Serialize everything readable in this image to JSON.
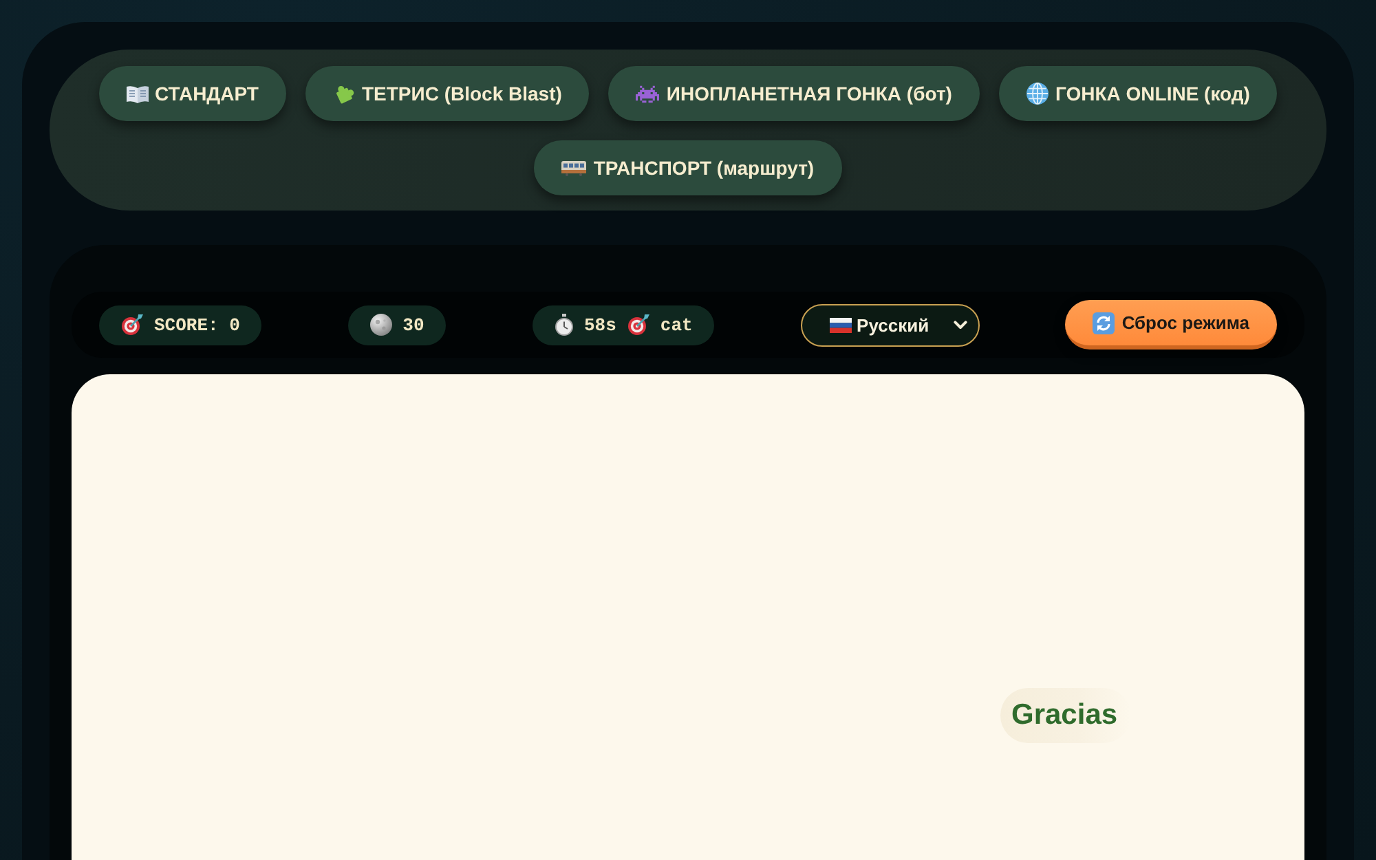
{
  "modes": [
    {
      "label": "СТАНДАРТ",
      "selected": false
    },
    {
      "label": "ТЕТРИС (Block Blast)",
      "selected": false
    },
    {
      "label": "ИНОПЛАНЕТНАЯ ГОНКА (бот)",
      "selected": false
    },
    {
      "label": "ГОНКА ONLINE (код)",
      "selected": false
    },
    {
      "label": "ТРАНСПОРТ (маршрут)",
      "selected": false
    }
  ],
  "stats": {
    "score": "SCORE: 0",
    "moons": "30",
    "time": "58s",
    "target": "cat"
  },
  "language_select": {
    "value": "Русский"
  },
  "reset_button": {
    "label": "Сброс режима"
  },
  "game_area": {
    "words": [
      {
        "text": "Gracias"
      }
    ]
  }
}
